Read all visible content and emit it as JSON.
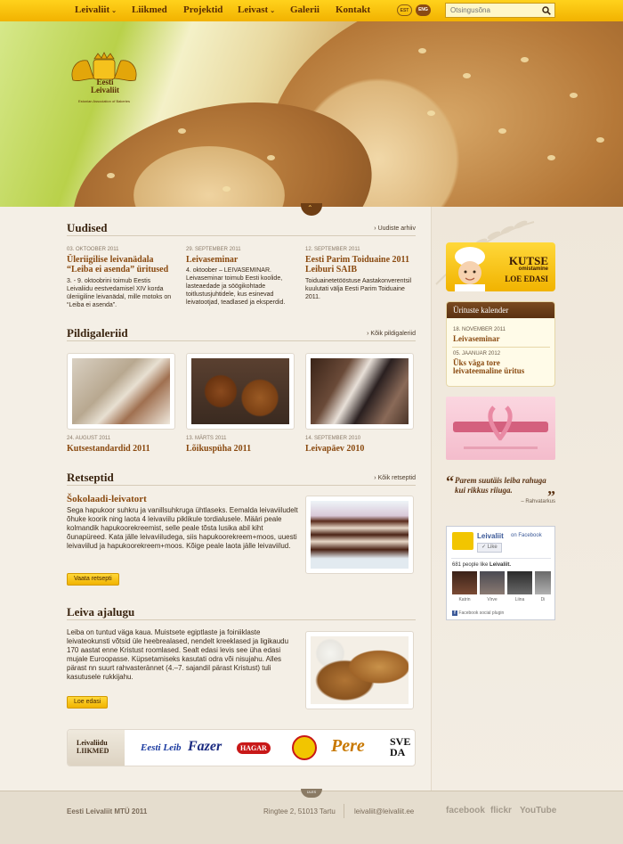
{
  "nav": {
    "items": [
      {
        "label": "Leivaliit",
        "has_menu": true
      },
      {
        "label": "Liikmed",
        "has_menu": false
      },
      {
        "label": "Projektid",
        "has_menu": false
      },
      {
        "label": "Leivast",
        "has_menu": true
      },
      {
        "label": "Galerii",
        "has_menu": false
      },
      {
        "label": "Kontakt",
        "has_menu": false
      }
    ],
    "lang_est": "EST",
    "lang_eng": "ENG",
    "search_placeholder": "Otsingusõna"
  },
  "logo": {
    "title_line1": "Eesti",
    "title_line2": "Leivaliit",
    "subtitle": "Estonian Association of Bakeries"
  },
  "news": {
    "title": "Uudised",
    "more": "Uudiste arhiiv",
    "items": [
      {
        "date": "03. oktoober 2011",
        "title": "Üleriigilise leivanädala “Leiba ei asenda” üritused",
        "text": "3. - 9. oktoobrini toimub Eestis Leivaliidu eestvedamisel XIV korda üleriigiline leivanädal, mille motoks on “Leiba ei asenda”."
      },
      {
        "date": "29. september 2011",
        "title": "Leivaseminar",
        "text": "4. oktoober – LEIVASEMINAR. Leivaseminar toimub Eesti koolide, lasteaedade ja söögikohtade toitlustusjuhtidele, kus esinevad leivatootjad, teadlased ja eksperdid."
      },
      {
        "date": "12. september 2011",
        "title": "Eesti Parim Toiduaine 2011 Leiburi SAIB",
        "text": "Toiduainetetööstuse Aastakonverentsil kuulutati välja Eesti Parim Toiduaine 2011."
      }
    ]
  },
  "gallery": {
    "title": "Pildigaleriid",
    "more": "Kõik pildigaleriid",
    "items": [
      {
        "date": "24. august 2011",
        "title": "Kutsestandardid 2011"
      },
      {
        "date": "13. märts 2011",
        "title": "Lõikuspüha 2011"
      },
      {
        "date": "14. september 2010",
        "title": "Leivapäev 2010"
      }
    ]
  },
  "recipes": {
    "title": "Retseptid",
    "more": "Kõik retseptid",
    "recipe_title": "Šokolaadi-leivatort",
    "text": "Sega hapukoor suhkru ja vanillsuhkruga ühtlaseks. Eemalda leivaviiludelt õhuke koorik ning laota 4 leivaviilu piklikule tordialusele. Määri peale kolmandik hapukoorekreemist, selle peale tõsta lusika abil kiht õunapüreed. Kata jälle leivaviiludega, siis hapukoorekreem+moos, uuesti leivaviilud ja hapukoorekreem+moos. Kõige peale laota jälle leivaviilud.",
    "button": "Vaata retsepti"
  },
  "history": {
    "title": "Leiva ajalugu",
    "text": "Leiba on tuntud väga kaua. Muistsete egiptlaste ja foiniiklaste leivateokunsti võtsid üle heebrealased, nendelt kreeklased ja ligikaudu 170 aastat enne Kristust roomlased. Sealt edasi levis see üha edasi mujale Euroopasse. Küpsetamiseks kasutati odra või nisujahu. Alles pärast nn suurt rahvasterännet (4.–7. sajandil pärast Kristust) tuli kasutusele rukkijahu.",
    "button": "Loe edasi"
  },
  "partners": {
    "label_line1": "Leivaliidu",
    "label_line2": "LIIKMED",
    "logos": [
      "Eesti Leib",
      "Fazer",
      "HAGAR",
      "Pere",
      "SVE DA"
    ]
  },
  "sidebar": {
    "kutse": {
      "title": "KUTSE",
      "subtitle": "omistamine",
      "link": "LOE EDASI"
    },
    "events": {
      "title": "Ürituste kalender",
      "items": [
        {
          "date": "18. november 2011",
          "title": "Leivaseminar"
        },
        {
          "date": "05. jaanuar 2012",
          "title": "Üks väga tore leivateemaline üritus"
        }
      ]
    },
    "quote": {
      "text": "Parem suutäis leiba rahuga kui rikkus riiuga.",
      "author": "– Rahvatarkus"
    },
    "facebook": {
      "page_name": "Leivaliit",
      "on_facebook": "on Facebook",
      "like_button": "Like",
      "count_text": "681 people like",
      "count_page": "Leivaliit.",
      "faces": [
        "Katrin",
        "Virve",
        "Liina",
        "Di"
      ],
      "plugin": "Facebook social plugin"
    }
  },
  "footer": {
    "tab": "ÜLES",
    "org": "Eesti Leivaliit MTÜ 2011",
    "address": "Ringtee 2, 51013 Tartu",
    "email": "leivaliit@leivaliit.ee",
    "social": [
      "facebook",
      "flickr",
      "YouTube"
    ]
  },
  "colors": {
    "accent": "#f2b200",
    "brown": "#5a2d05",
    "link": "#8a4a10"
  }
}
